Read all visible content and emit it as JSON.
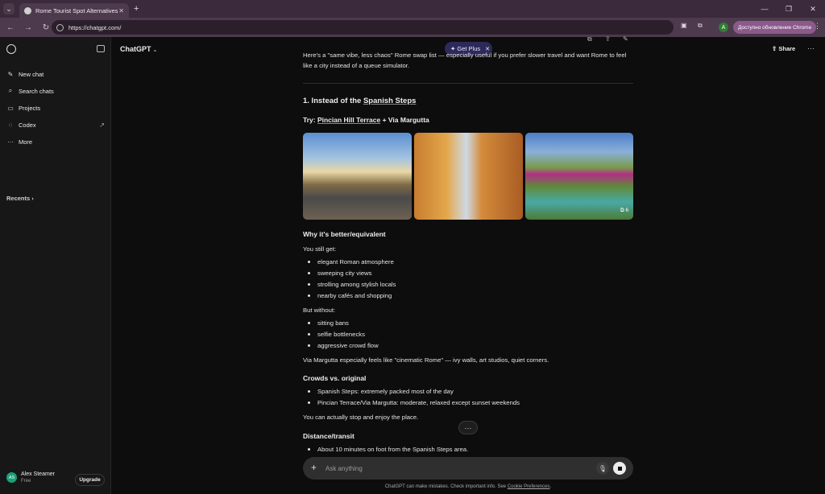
{
  "browser": {
    "tab_title": "Rome Tourist Spot Alternatives",
    "url": "https://chatgpt.com/",
    "profile_initial": "A",
    "update_label": "Доступно обновление Chrome"
  },
  "sidebar": {
    "items": [
      {
        "label": "New chat",
        "icon": "compose-icon"
      },
      {
        "label": "Search chats",
        "icon": "search-icon"
      },
      {
        "label": "Projects",
        "icon": "folder-icon"
      },
      {
        "label": "Codex",
        "icon": "codex-icon"
      },
      {
        "label": "More",
        "icon": "dots-icon"
      }
    ],
    "recents_label": "Recents",
    "user": {
      "initials": "AS",
      "name": "Alex Steamer",
      "plan": "Free"
    },
    "upgrade_label": "Upgrade"
  },
  "header": {
    "model": "ChatGPT",
    "get_plus": "Get Plus",
    "share": "Share"
  },
  "content": {
    "intro": "Here's a \"same vibe, less chaos\" Rome swap list — especially useful if you prefer slower travel and want Rome to feel like a city instead of a queue simulator.",
    "section_title_prefix": "1. Instead of the ",
    "section_title_link": "Spanish Steps",
    "try_prefix": "Try: ",
    "try_link": "Pincian Hill Terrace",
    "try_suffix": " + Via Margutta",
    "image_count": "6",
    "why_heading": "Why it's better/equivalent",
    "you_still_get": "You still get:",
    "get_list": [
      "elegant Roman atmosphere",
      "sweeping city views",
      "strolling among stylish locals",
      "nearby cafés and shopping"
    ],
    "but_without": "But without:",
    "without_list": [
      "sitting bans",
      "selfie bottlenecks",
      "aggressive crowd flow"
    ],
    "via_margutta_note": "Via Margutta especially feels like \"cinematic Rome\" — ivy walls, art studios, quiet corners.",
    "crowds_heading": "Crowds vs. original",
    "crowds_list": [
      "Spanish Steps: extremely packed most of the day",
      "Pincian Terrace/Via Margutta: moderate, relaxed except sunset weekends"
    ],
    "crowds_note": "You can actually stop and enjoy the place.",
    "distance_heading": "Distance/transit",
    "distance_list": [
      "About 10 minutes on foot from the Spanish Steps area."
    ]
  },
  "composer": {
    "placeholder": "Ask anything"
  },
  "footer": {
    "disclaimer": "ChatGPT can make mistakes. Check important info. See ",
    "cookie_link": "Cookie Preferences",
    "end": "."
  }
}
